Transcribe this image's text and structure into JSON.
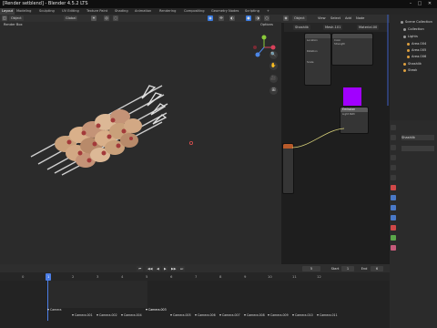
{
  "window": {
    "title": "[Render setblend] - Blender 4.5.2 LTS",
    "minimize": "–",
    "maximize": "□",
    "close": "✕"
  },
  "workspaces": [
    "Layout",
    "Modeling",
    "Sculpting",
    "UV Editing",
    "Texture Paint",
    "Shading",
    "Animation",
    "Rendering",
    "Compositing",
    "Geometry Nodes",
    "Scripting",
    "+"
  ],
  "active_workspace": "Layout",
  "viewport": {
    "mode": "Object",
    "view": "View",
    "select": "Select",
    "add": "Add",
    "object": "Object",
    "transform": "Global",
    "options": "Options",
    "collection_label": "Render Box",
    "nav": [
      "⊕",
      "✋",
      "🔍",
      "⊞",
      "🎥",
      "⌂"
    ]
  },
  "node_editor": {
    "menus": [
      "Object",
      "View",
      "Select",
      "Add",
      "Node"
    ],
    "node_shashlik": "Shashlik",
    "node_mesh": "Mesh.101",
    "node_material": "Material.00",
    "node_output": "Material Outp",
    "node_emission": "Emission",
    "node_light": "Light Path",
    "rows": [
      "Location",
      "Rotation",
      "Scale",
      "Color",
      "Strength"
    ],
    "color_swatch": "#a100ff",
    "link_color": "#d9d27a"
  },
  "outliner": {
    "items": [
      {
        "label": "Scene Collection",
        "color": "#9a9a9a"
      },
      {
        "label": "Collection",
        "color": "#9a9a9a"
      },
      {
        "label": "Lights",
        "color": "#9a9a9a"
      },
      {
        "label": "Area.004",
        "color": "#e0a13f"
      },
      {
        "label": "Area.005",
        "color": "#e0a13f"
      },
      {
        "label": "Area.006",
        "color": "#e0a13f"
      },
      {
        "label": "Shashlik",
        "color": "#e0a13f"
      },
      {
        "label": "Steak",
        "color": "#e0a13f"
      }
    ]
  },
  "properties": {
    "object_name": "Shashlik"
  },
  "timeline": {
    "frame_current": "5",
    "start_label": "Start",
    "start": "1",
    "end_label": "End",
    "end": "6",
    "ticks": [
      "0",
      "1",
      "2",
      "3",
      "4",
      "5",
      "6",
      "7",
      "8",
      "9",
      "10",
      "11",
      "12"
    ],
    "markers": [
      "Camera",
      "Camera.001",
      "Camera.002",
      "Camera.003",
      "Camera.004",
      "Camera.005",
      "Camera.006",
      "Camera.007",
      "Camera.008",
      "Camera.009",
      "Camera.010",
      "Camera.011"
    ],
    "selected_marker": "Camera.003",
    "playback": [
      "⏮",
      "◀◀",
      "◀",
      "▶",
      "▶▶",
      "⏭"
    ]
  },
  "colors": {
    "accent": "#3a7be0",
    "frame_marker": "#4c7ee6"
  }
}
